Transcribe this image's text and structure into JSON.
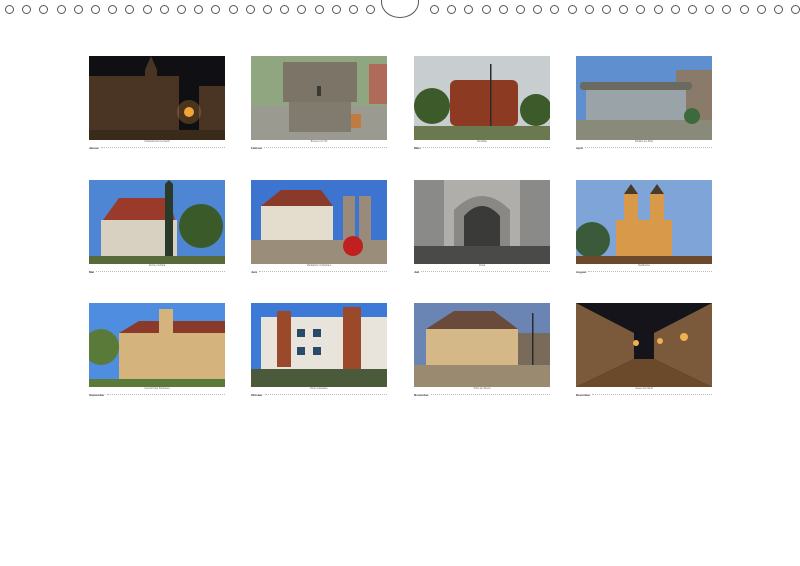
{
  "months": [
    {
      "id": "jan",
      "name": "Januar",
      "caption": "Schlosskirche bei Nacht",
      "sky": "#101014",
      "ground": "#3a2a1a",
      "bld": "#4a3524",
      "accent": "#f2a43a"
    },
    {
      "id": "feb",
      "name": "Februar",
      "caption": "Brunnen im Hof",
      "sky": "#8fa680",
      "ground": "#9a9a90",
      "bld": "#7d7468",
      "accent": "#c07c40"
    },
    {
      "id": "mar",
      "name": "März",
      "caption": "Rundbau",
      "sky": "#c8cdd0",
      "ground": "#6a7a4e",
      "bld": "#8c3a22",
      "accent": "#3d5a2a"
    },
    {
      "id": "apr",
      "name": "April",
      "caption": "Pavillon am Platz",
      "sky": "#5f8fcf",
      "ground": "#8a8a7a",
      "bld": "#6a6a60",
      "accent": "#3c6a3c"
    },
    {
      "id": "may",
      "name": "Mai",
      "caption": "Kirche mit Park",
      "sky": "#4f86d4",
      "ground": "#586a3a",
      "bld": "#d8d0c0",
      "accent": "#9a3a2a"
    },
    {
      "id": "jun",
      "name": "Juni",
      "caption": "Marktplatz mit Rathaus",
      "sky": "#3d74cf",
      "ground": "#9a8e7a",
      "bld": "#e4dccc",
      "accent": "#c02020"
    },
    {
      "id": "jul",
      "name": "Juli",
      "caption": "Portal",
      "sky": "#8a8a88",
      "ground": "#4a4a48",
      "bld": "#b0aeaa",
      "accent": "#3a3a38"
    },
    {
      "id": "aug",
      "name": "August",
      "caption": "Stadtkirche",
      "sky": "#7fa4d8",
      "ground": "#6a4a2a",
      "bld": "#d89a4a",
      "accent": "#3a5a3a"
    },
    {
      "id": "sep",
      "name": "September",
      "caption": "Innenhof des Schlosses",
      "sky": "#4f8de0",
      "ground": "#5a7a3a",
      "bld": "#d4b47c",
      "accent": "#8a3a2a"
    },
    {
      "id": "oct",
      "name": "Oktober",
      "caption": "Bunte Fassaden",
      "sky": "#3d7ad8",
      "ground": "#4a5a3a",
      "bld": "#e8e4dc",
      "accent": "#9a4a2a"
    },
    {
      "id": "nov",
      "name": "November",
      "caption": "Platz am Abend",
      "sky": "#6a84b4",
      "ground": "#9a8a70",
      "bld": "#d4b888",
      "accent": "#6a4a3a"
    },
    {
      "id": "dec",
      "name": "Dezember",
      "caption": "Gasse bei Nacht",
      "sky": "#14141a",
      "ground": "#6a4a2a",
      "bld": "#7a5a3a",
      "accent": "#f0b050"
    }
  ]
}
